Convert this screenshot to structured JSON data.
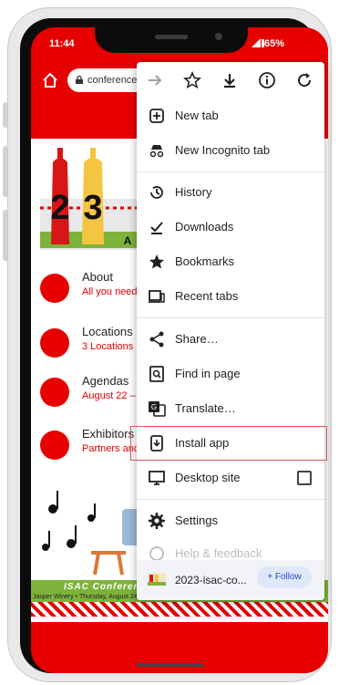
{
  "status": {
    "time": "11:44",
    "battery": "65%"
  },
  "browser": {
    "url_text": "conference"
  },
  "page": {
    "list": [
      {
        "title": "About",
        "subtitle": "All you need"
      },
      {
        "title": "Locations",
        "subtitle": "3 Locations"
      },
      {
        "title": "Agendas",
        "subtitle": "August 22 –"
      },
      {
        "title": "Exhibitors",
        "subtitle": "Partners and"
      }
    ],
    "banner_title": "ISAC Conferen",
    "banner_sub": "Jasper Winery  •  Thursday, August 24  •  6 pm - 9 pm  •  Must be pre-registered"
  },
  "menu": {
    "toolbar": [
      "forward-icon",
      "star-icon",
      "download-icon",
      "info-icon",
      "refresh-icon"
    ],
    "items": [
      {
        "label": "New tab",
        "icon": "new-tab-icon"
      },
      {
        "label": "New Incognito tab",
        "icon": "incognito-icon"
      },
      {
        "label": "History",
        "icon": "history-icon"
      },
      {
        "label": "Downloads",
        "icon": "downloads-icon"
      },
      {
        "label": "Bookmarks",
        "icon": "bookmarks-icon"
      },
      {
        "label": "Recent tabs",
        "icon": "recent-tabs-icon"
      },
      {
        "label": "Share…",
        "icon": "share-icon"
      },
      {
        "label": "Find in page",
        "icon": "find-icon"
      },
      {
        "label": "Translate…",
        "icon": "translate-icon"
      },
      {
        "label": "Install app",
        "icon": "install-app-icon"
      },
      {
        "label": "Desktop site",
        "icon": "desktop-icon"
      },
      {
        "label": "Settings",
        "icon": "settings-icon"
      },
      {
        "label": "Help & feedback",
        "icon": "help-icon"
      }
    ],
    "footer": {
      "site": "2023-isac-co...",
      "follow": "+ Follow"
    }
  },
  "colors": {
    "brand_red": "#e60000",
    "green": "#7db33b"
  }
}
